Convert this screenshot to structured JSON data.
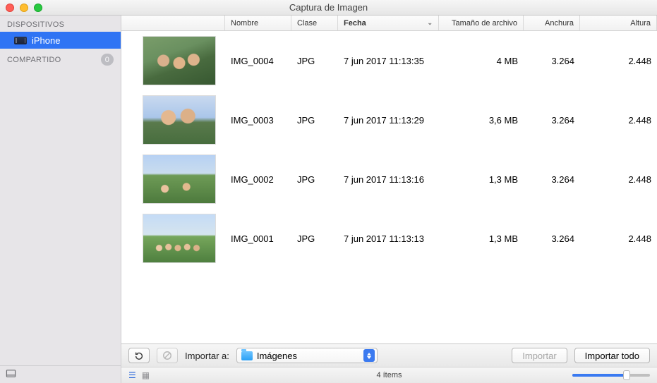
{
  "window": {
    "title": "Captura de Imagen"
  },
  "sidebar": {
    "sections": {
      "devices_label": "DISPOSITIVOS",
      "shared_label": "COMPARTIDO",
      "shared_count": "0"
    },
    "device_name": "iPhone"
  },
  "columns": {
    "name": "Nombre",
    "kind": "Clase",
    "date": "Fecha",
    "size": "Tamaño de archivo",
    "width": "Anchura",
    "height": "Altura"
  },
  "rows": [
    {
      "name": "IMG_0004",
      "kind": "JPG",
      "date": "7 jun 2017 11:13:35",
      "size": "4 MB",
      "w": "3.264",
      "h": "2.448"
    },
    {
      "name": "IMG_0003",
      "kind": "JPG",
      "date": "7 jun 2017 11:13:29",
      "size": "3,6 MB",
      "w": "3.264",
      "h": "2.448"
    },
    {
      "name": "IMG_0002",
      "kind": "JPG",
      "date": "7 jun 2017 11:13:16",
      "size": "1,3 MB",
      "w": "3.264",
      "h": "2.448"
    },
    {
      "name": "IMG_0001",
      "kind": "JPG",
      "date": "7 jun 2017 11:13:13",
      "size": "1,3 MB",
      "w": "3.264",
      "h": "2.448"
    }
  ],
  "toolbar": {
    "import_to_label": "Importar a:",
    "folder": "Imágenes",
    "import": "Importar",
    "import_all": "Importar todo"
  },
  "status": {
    "count": "4 ítems"
  }
}
